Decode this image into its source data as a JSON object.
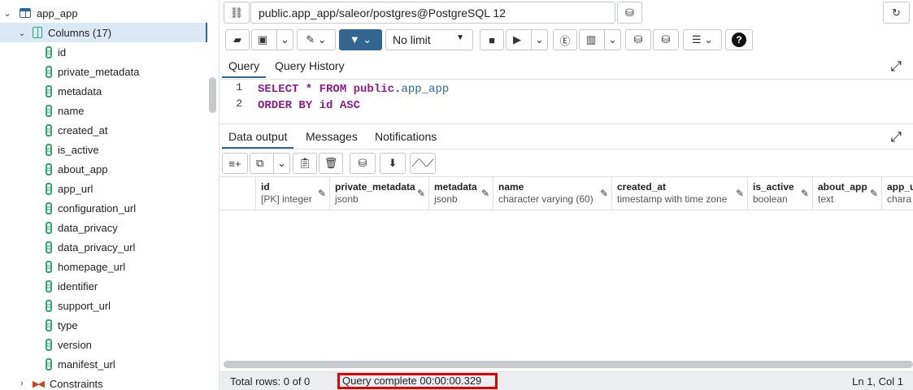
{
  "sidebar": {
    "table_name": "app_app",
    "columns_label": "Columns (17)",
    "columns": [
      "id",
      "private_metadata",
      "metadata",
      "name",
      "created_at",
      "is_active",
      "about_app",
      "app_url",
      "configuration_url",
      "data_privacy",
      "data_privacy_url",
      "homepage_url",
      "identifier",
      "support_url",
      "type",
      "version",
      "manifest_url"
    ],
    "constraints_label": "Constraints"
  },
  "toolbar": {
    "connection": "public.app_app/saleor/postgres@PostgreSQL 12",
    "limit_label": "No limit"
  },
  "editor": {
    "tabs": [
      "Query",
      "Query History"
    ],
    "line_numbers": [
      "1",
      "2"
    ],
    "line1": {
      "kw1": "SELECT * FROM",
      "kw2": "public.",
      "ident": "app_app"
    },
    "line2": {
      "kw": "ORDER BY id ASC"
    }
  },
  "output": {
    "tabs": [
      "Data output",
      "Messages",
      "Notifications"
    ],
    "columns": [
      {
        "name": "id",
        "type": "[PK] integer"
      },
      {
        "name": "private_metadata",
        "type": "jsonb"
      },
      {
        "name": "metadata",
        "type": "jsonb"
      },
      {
        "name": "name",
        "type": "character varying (60)"
      },
      {
        "name": "created_at",
        "type": "timestamp with time zone"
      },
      {
        "name": "is_active",
        "type": "boolean"
      },
      {
        "name": "about_app",
        "type": "text"
      },
      {
        "name": "app_u",
        "type": "chara"
      }
    ]
  },
  "status": {
    "total_rows": "Total rows: 0 of 0",
    "query_time": "Query complete 00:00:00.329",
    "cursor": "Ln 1, Col 1"
  },
  "colors": {
    "accent": "#326690",
    "highlight": "#e00000"
  }
}
